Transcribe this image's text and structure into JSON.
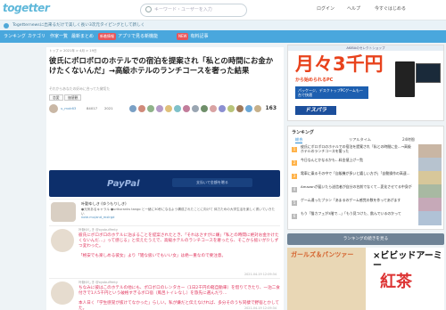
{
  "header": {
    "logo": "togetter",
    "search_placeholder": "キーワード・ユーザーを入力",
    "links": [
      "ログイン",
      "ヘルプ",
      "今すぐはじめる"
    ],
    "notice": "Togetternewsに出来るだけで美しく長い3次元タイピングとして新しく"
  },
  "nav": {
    "items": [
      "ランキング",
      "カテゴリ",
      "作家一覧",
      "最新まとめ",
      "アプリで見る新機能",
      "Togetter",
      "有料記事"
    ],
    "badges": [
      "新着情報",
      "NEW"
    ]
  },
  "article": {
    "breadcrumb": "トップ > 2021年 > 4月 > 19日",
    "title": "彼氏にボロボロのホテルでの宿泊を提案され「私との時間にお金かけたくないんだ」→高級ホテルのランチコースを奢った結果",
    "subtitle": "それからあなたの好みに合ってた貸切た",
    "tags": [
      "恋愛",
      "価値観"
    ],
    "creator": "u_mxk63",
    "views": "84017",
    "date": "2021",
    "fav_count": "163"
  },
  "paypal": {
    "logo": "PayPal",
    "button": "支払いで金額を贈る"
  },
  "profile": {
    "name": "叶勤ゆしき (ゆうもりしき)",
    "desc": "●元気あるキャラル ●urikuranks tango と一緒に30秒になるよう構成されたことに向けて 体力ための大学生活を楽しく書いていきたい",
    "links": "note.mu/and_mxlrgd"
  },
  "tweets": [
    {
      "name": "叶勤ゆしき @xyxbul9mty",
      "lines": [
        "彼氏にボロボロのホテルに泊まることを提案されたとき、「それはさすがに嫌」「私との時間に絶対お金かけたくないんだ…」って感じる」と伝えたうえで、高級ホテルのランチコースを奢ったら、そこから扱いが少しずつ変わった。"
      ],
      "highlight": "「格安でも楽しめる彼女」より「雑な扱いでもいい女」は絶一重なので要注意。",
      "time": "2021-04-19 12:09:34"
    },
    {
      "name": "叶勤ゆしき @xyxbul9mty",
      "lines": [
        "ちなみに彼はこのホテルの他にも、ポロボロのレンタカー（1日2千円の軽自動車）を借りてきたり、一泊二食付きで1人5千円という破格すぎるボロ宿（風呂トイレなし）を旅先に選んだり…",
        "本人日く「学生感覚が抜けてなかった」らしい。私が嫌だと伝えなければ、多分そのうち同棲で野宿とかしてた。"
      ],
      "highlight": "",
      "time": "2021-04-19 12:09:34"
    }
  ],
  "ad_top": {
    "label": "AKIBAのセレクトショップ",
    "big": "月々3千円",
    "sub": "から始められるPC",
    "band": "パッケージ、デスクトップPCゲームも一台で快適",
    "brand": "ドスパラ"
  },
  "ranking": {
    "heading": "ランキング",
    "tabs": [
      "総合",
      "リアルタイム",
      "24時間"
    ],
    "items": [
      "彼氏にボロボロのホテルでの宿泊を提案され「私との時間に金…→高級ホテルのランチコースを奢った",
      "今日なんとかなるかも…料金値上げ一覧",
      "電車に乗るその中で「自販機が多いと嬉しい方が」「自動操作の高速…",
      "Amazonが届いたら送信者が自分の名前でなくて…変化させてる中身が",
      "ゲーム通ったプラン「あまるのゲーム感覚の数を作ってあげます",
      "もう「猫カフェが3階で…」「もう見つけた、飲んでいるのかって"
    ],
    "button": "ランキングの続きを見る"
  },
  "ad_bottom": {
    "left": "ガールズ＆パンツァー",
    "title": "×ビビッドアーミー",
    "kanji": "紅茶"
  }
}
